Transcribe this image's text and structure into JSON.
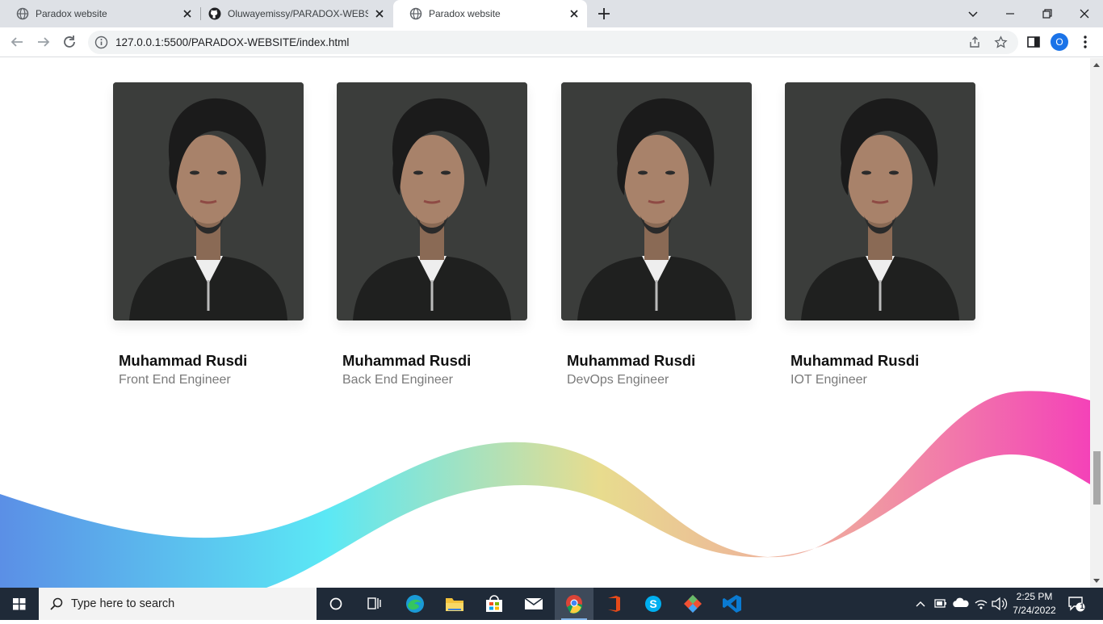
{
  "browser": {
    "tabs": [
      {
        "title": "Paradox website",
        "favicon": "globe-icon",
        "active": false
      },
      {
        "title": "Oluwayemissy/PARADOX-WEBSITE",
        "favicon": "github-icon",
        "active": false
      },
      {
        "title": "Paradox website",
        "favicon": "globe-icon",
        "active": true
      }
    ],
    "address": "127.0.0.1:5500/PARADOX-WEBSITE/index.html",
    "profile_initial": "O"
  },
  "team": {
    "members": [
      {
        "name": "Muhammad Rusdi",
        "role": "Front End Engineer"
      },
      {
        "name": "Muhammad Rusdi",
        "role": "Back End Engineer"
      },
      {
        "name": "Muhammad Rusdi",
        "role": "DevOps Engineer"
      },
      {
        "name": "Muhammad Rusdi",
        "role": "IOT Engineer"
      }
    ]
  },
  "wave_colors": [
    "#5b8fe6",
    "#5be8f5",
    "#e8dc8e",
    "#f0a0a0",
    "#f442b8"
  ],
  "taskbar": {
    "search_placeholder": "Type here to search",
    "time": "2:25 PM",
    "date": "7/24/2022",
    "notification_count": "1"
  }
}
